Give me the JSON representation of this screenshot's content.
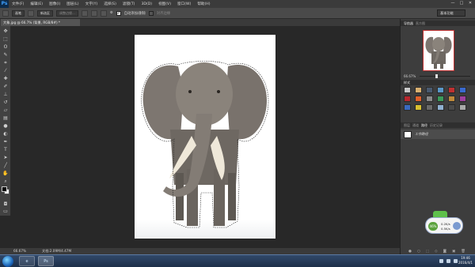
{
  "menubar": {
    "logo": "Ps",
    "items": [
      "文件(F)",
      "编辑(E)",
      "图像(I)",
      "图层(L)",
      "文字(Y)",
      "选择(S)",
      "滤镜(T)",
      "3D(D)",
      "视图(V)",
      "窗口(W)",
      "帮助(H)"
    ],
    "window_controls": [
      "—",
      "□",
      "✕"
    ]
  },
  "options_bar": {
    "preset": "画笔",
    "mode": "新选区",
    "refine": "调整边缘...",
    "auto_enhance_checked": true,
    "auto_enhance_label": "自动添加/删除",
    "align_edges_label": "对齐边缘",
    "workspace": "基本功能"
  },
  "document": {
    "tab_title": "大象.jpg @ 66.7% (背景, RGB/8#) *",
    "zoom": "66.67%",
    "doc_info": "文档:2.09M/4.47M"
  },
  "panels": {
    "navigator_tabs": [
      "导航器",
      "直方图"
    ],
    "navigator_zoom": "66.67%",
    "swatches_tabs": [
      "样式"
    ],
    "swatch_colors": [
      "#c9c9c9",
      "#d9b070",
      "#4a5a70",
      "#5a98c8",
      "#c03030",
      "#3a6acf",
      "#b8282e",
      "#e0602a",
      "#8a8a8a",
      "#3a9a5a",
      "#c08a3a",
      "#a040a0",
      "#3a6abf",
      "#d8c030",
      "#6a6a6a",
      "#8fb0d0",
      "#4a4a4a",
      "#a9a9a9"
    ],
    "layers_tabs": [
      "图层",
      "通道",
      "路径",
      "历史记录"
    ],
    "layer_name": "工作路径"
  },
  "widget": {
    "badge": "46%",
    "up_speed": "0.2K/s",
    "down_speed": "0.5K/s"
  },
  "taskbar": {
    "time": "19:46",
    "date": "2016/4/1",
    "apps": [
      "ie-icon",
      "photoshop-icon"
    ]
  }
}
